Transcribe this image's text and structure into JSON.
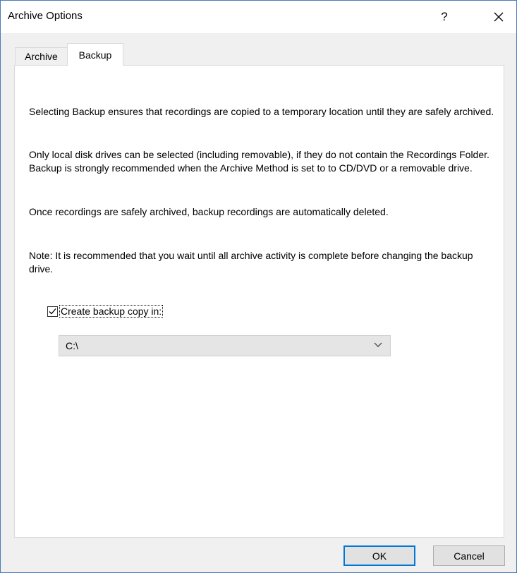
{
  "window": {
    "title": "Archive Options",
    "help_label": "?",
    "close_icon": "close-icon"
  },
  "tabs": [
    {
      "label": "Archive",
      "selected": false
    },
    {
      "label": "Backup",
      "selected": true
    }
  ],
  "backup_tab": {
    "paragraphs": [
      "Selecting Backup ensures that recordings are copied to a temporary location until they are safely archived.",
      "Only local disk drives can be selected (including removable), if they do not contain the Recordings Folder.  Backup is strongly recommended when the Archive Method is set to to CD/DVD or a removable drive.",
      "Once recordings are safely archived, backup recordings are automatically deleted.",
      "Note:  It is recommended that you wait until all archive activity is complete before changing the backup drive."
    ],
    "create_backup": {
      "label": "Create backup copy in:",
      "checked": true
    },
    "drive_select": {
      "value": "C:\\"
    }
  },
  "buttons": {
    "ok": "OK",
    "cancel": "Cancel"
  }
}
